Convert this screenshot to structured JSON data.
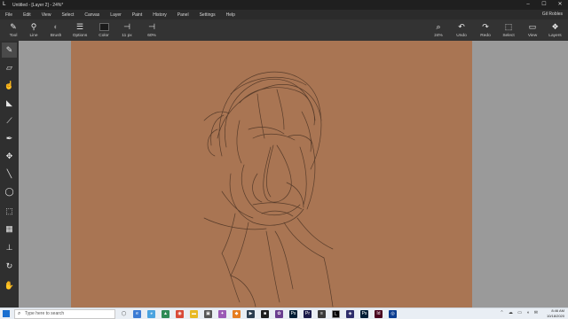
{
  "window": {
    "title": "Untitled - [Layer 2] - 24%*",
    "minimize": "–",
    "maximize": "☐",
    "close": "✕"
  },
  "menu": {
    "items": [
      "File",
      "Edit",
      "View",
      "Select",
      "Canvas",
      "Layer",
      "Paint",
      "History",
      "Panel",
      "Settings",
      "Help"
    ],
    "user": "Gil Robles"
  },
  "toolbar": {
    "tool": "Tool",
    "line": "Line",
    "brush": "Brush",
    "options": "Options",
    "color": "Color",
    "size": "11 px",
    "opacity": "60%",
    "zoom": "24%",
    "undo": "Undo",
    "redo": "Redo",
    "select": "Select",
    "view": "View",
    "layers": "Layers"
  },
  "colors": {
    "swatch": "#1b1b1b",
    "canvas": "#a97553",
    "stroke": "#4a3324"
  },
  "sidebar_tools": [
    "brush-icon",
    "eraser-icon",
    "smudge-icon",
    "fill-icon",
    "eyedropper-icon",
    "pen-icon",
    "move-icon",
    "line-icon",
    "lasso-icon",
    "rect-select-icon",
    "gradient-icon",
    "stamp-icon",
    "rotate-icon",
    "hand-icon"
  ],
  "taskbar": {
    "search_placeholder": "Type here to search",
    "time": "8:46 AM",
    "date": "10/18/2020"
  }
}
